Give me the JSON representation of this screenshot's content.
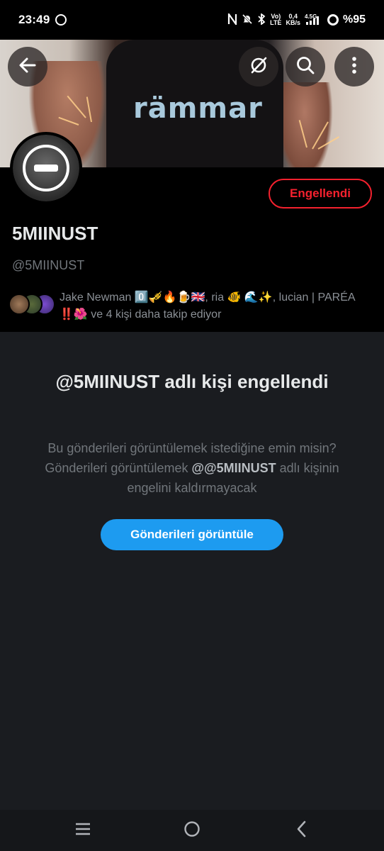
{
  "status_bar": {
    "time": "23:49",
    "volte": "Vo)\nLTE",
    "data_speed": "0,4\nKB/s",
    "network": "4.5G",
    "battery": "%95"
  },
  "header": {
    "back_icon": "arrow-left-icon",
    "unavailable_icon": "slash-circle-icon",
    "search_icon": "search-icon",
    "more_icon": "more-vertical-icon",
    "banner_text": "rämmar"
  },
  "profile": {
    "blocked_button_label": "Engellendi",
    "display_name": "5MIINUST",
    "handle": "@5MIINUST",
    "followers_text": "Jake Newman 0️⃣🎺🔥🍺🇬🇧, ria 🐠 🌊✨, lucian | PARÉA ‼️🌺 ve 4 kişi daha takip ediyor"
  },
  "blocked_notice": {
    "title": "@5MIINUST adlı kişi engellendi",
    "body_before": "Bu gönderileri görüntülemek istediğine emin misin? Gönderileri görüntülemek ",
    "body_handle": "@@5MIINUST",
    "body_after": " adlı kişinin engelini kaldırmayacak",
    "view_button_label": "Gönderileri görüntüle"
  },
  "nav_bar": {
    "recents_icon": "menu-icon",
    "home_icon": "circle-home-icon",
    "back_icon": "chevron-left-icon"
  },
  "colors": {
    "blocked_red": "#f4212e",
    "accent_blue": "#1d9bf0",
    "panel_bg": "#1a1c20"
  }
}
